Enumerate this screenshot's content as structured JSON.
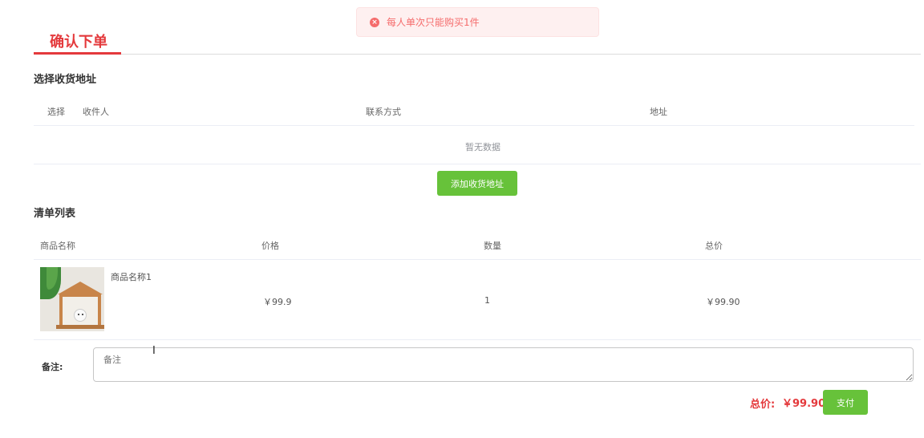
{
  "toast": {
    "icon": "error-circle-icon",
    "message": "每人单次只能购买1件",
    "color": "#f56c6c"
  },
  "page": {
    "title": "确认下单",
    "accent": "#e4393c"
  },
  "address": {
    "section_title": "选择收货地址",
    "columns": [
      "选择",
      "收件人",
      "联系方式",
      "地址"
    ],
    "empty_text": "暂无数据",
    "add_button": "添加收货地址"
  },
  "cart": {
    "section_title": "清单列表",
    "columns": [
      "商品名称",
      "价格",
      "数量",
      "总价"
    ],
    "rows": [
      {
        "name": "商品名称1",
        "price": "￥99.9",
        "quantity": "1",
        "total": "￥99.90"
      }
    ]
  },
  "remark": {
    "label": "备注:",
    "placeholder": "备注"
  },
  "footer": {
    "total_label": "总价:",
    "total_value": "￥99.90",
    "pay_button": "支付",
    "button_color": "#67c23a"
  }
}
